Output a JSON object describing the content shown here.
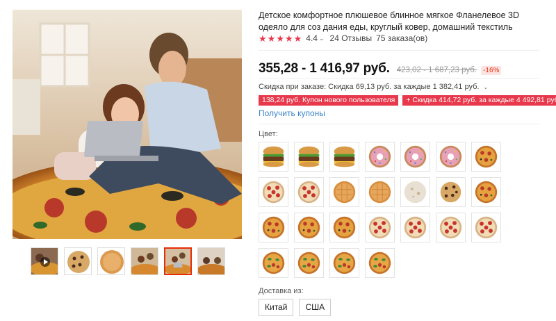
{
  "product": {
    "title": "Детское комфортное плюшевое блинное мягкое Фланелевое 3D одеяло для соз дания еды, круглый ковер, домашний текстиль",
    "rating": "4.4",
    "rating_count": 4.4,
    "reviews": "24 Отзывы",
    "orders": "75 заказа(ов)"
  },
  "price": {
    "current": "355,28 - 1 416,97 руб.",
    "old": "423,02 - 1 687,23 руб.",
    "discount": "-16%"
  },
  "order_discount": {
    "text": "Скидка при заказе: Скидка 69,13 руб. за каждые 1 382,41 руб."
  },
  "coupons": [
    "138,24 руб. Купон нового пользователя",
    "+ Скидка 414,72 руб. за каждые 4 492,81 руб."
  ],
  "get_coupons_label": "Получить купоны",
  "color_label": "Цвет:",
  "swatch_rows": [
    [
      "burger",
      "burger",
      "burger",
      "donut",
      "donut",
      "donut",
      "pizza"
    ],
    [
      "pepperoni",
      "pepperoni",
      "tortilla",
      "tortilla",
      "flatbread",
      "cookie",
      "pizza"
    ],
    [
      "pizza",
      "pizza",
      "pizza",
      "pepperoni",
      "pepperoni",
      "pepperoni",
      "pepperoni"
    ],
    [
      "pizza-green",
      "pizza-green",
      "pizza-green",
      "pizza-green"
    ]
  ],
  "thumbnails": [
    "video-thumb",
    "cookie-thumb",
    "tortilla-thumb",
    "lifestyle-thumb",
    "lifestyle-thumb",
    "lifestyle-thumb"
  ],
  "active_thumbnail": 4,
  "shipping": {
    "label": "Доставка из:",
    "options": [
      "Китай",
      "США"
    ]
  },
  "colors": {
    "accent": "#e8384b",
    "link": "#3c84c8",
    "price": "#111111",
    "active_border": "#e62e04"
  }
}
